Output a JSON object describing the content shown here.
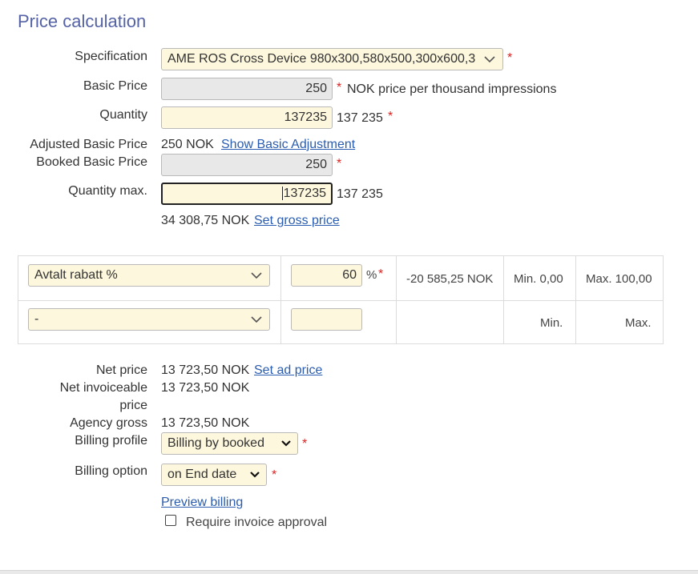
{
  "page": {
    "title": "Price calculation"
  },
  "form": {
    "specification": {
      "label": "Specification",
      "value": "AME ROS Cross Device 980x300,580x500,300x600,3"
    },
    "basic_price": {
      "label": "Basic Price",
      "value": "250",
      "note": "NOK price per thousand impressions"
    },
    "quantity": {
      "label": "Quantity",
      "value": "137235",
      "formatted": "137 235"
    },
    "adjusted_basic_price": {
      "label": "Adjusted Basic Price",
      "value": "250 NOK",
      "link": "Show Basic Adjustment"
    },
    "booked_basic_price": {
      "label": "Booked Basic Price",
      "value": "250"
    },
    "quantity_max": {
      "label": "Quantity max.",
      "value": "137235",
      "formatted": "137 235"
    },
    "gross": {
      "value": "34 308,75 NOK",
      "link": "Set gross price"
    },
    "required_mark": "*"
  },
  "discounts": {
    "rows": [
      {
        "type": "Avtalt rabatt %",
        "value": "60",
        "unit": "%",
        "amount": "-20 585,25 NOK",
        "min": "Min. 0,00",
        "max": "Max. 100,00"
      },
      {
        "type": "-",
        "value": "",
        "unit": "",
        "amount": "",
        "min": "Min.",
        "max": "Max."
      }
    ]
  },
  "summary": {
    "net_price": {
      "label": "Net price",
      "value": "13 723,50 NOK",
      "link": "Set ad price"
    },
    "net_invoiceable_price": {
      "label_line1": "Net invoiceable",
      "label_line2": "price",
      "value": "13 723,50 NOK"
    },
    "agency_gross": {
      "label": "Agency gross",
      "value": "13 723,50 NOK"
    },
    "billing_profile": {
      "label": "Billing profile",
      "value": "Billing by booked"
    },
    "billing_option": {
      "label": "Billing option",
      "value": "on End date"
    },
    "preview_billing": "Preview billing",
    "require_invoice_approval": {
      "label": "Require invoice approval",
      "checked": false
    }
  }
}
